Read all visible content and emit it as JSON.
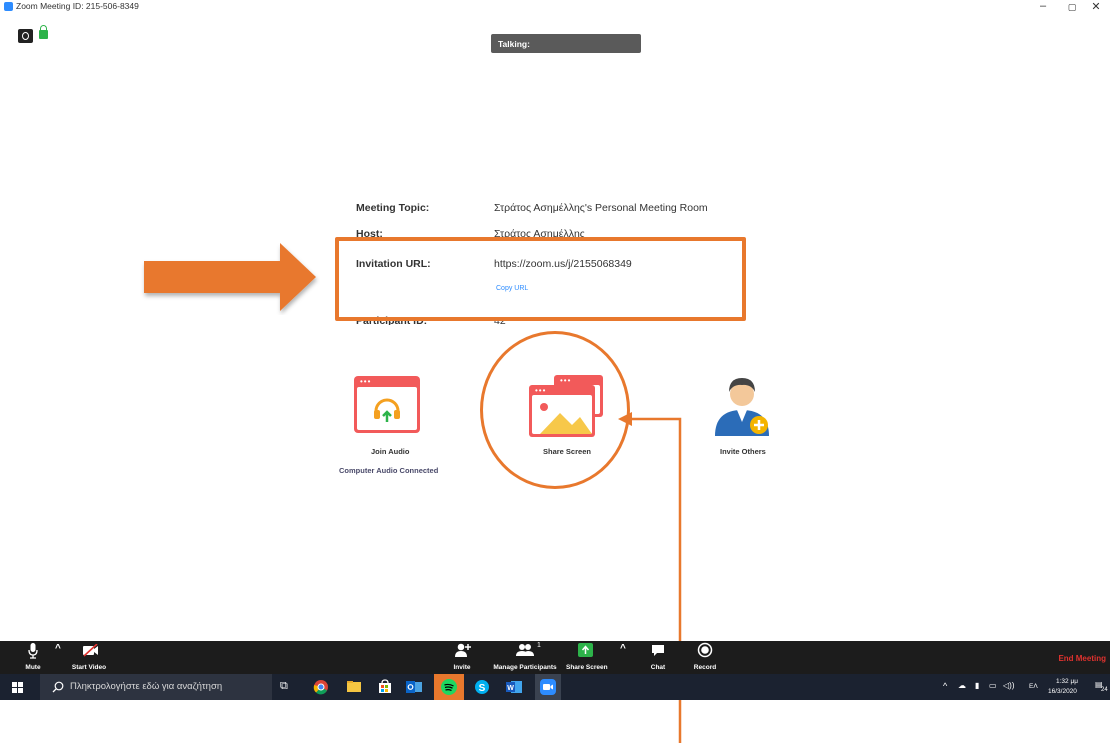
{
  "window": {
    "title": "Zoom Meeting ID: 215-506-8349",
    "minimize": "–",
    "restore": "▢",
    "close": "✕"
  },
  "talking": {
    "label": "Talking:"
  },
  "meeting_info": {
    "topic_label": "Meeting Topic:",
    "topic_value": "Στράτος Ασημέλλης's Personal Meeting Room",
    "host_label": "Host:",
    "host_value": "Στράτος Ασημέλλης",
    "invitation_label": "Invitation URL:",
    "invitation_value": "https://zoom.us/j/2155068349",
    "copy_url": "Copy URL",
    "participant_label": "Participant ID:",
    "participant_value": "42"
  },
  "actions": {
    "join_audio": "Join Audio",
    "join_audio_sub": "Computer Audio Connected",
    "share_screen": "Share Screen",
    "invite_others": "Invite Others"
  },
  "toolbar": {
    "mute": "Mute",
    "start_video": "Start Video",
    "invite": "Invite",
    "manage_participants": "Manage Participants",
    "participant_count": "1",
    "share_screen": "Share Screen",
    "chat": "Chat",
    "record": "Record",
    "end_meeting": "End Meeting"
  },
  "taskbar": {
    "search_placeholder": "Πληκτρολογήστε εδώ για αναζήτηση",
    "language": "ΕΛ",
    "time": "1:32 μμ",
    "date": "16/3/2020",
    "notifications": "24"
  },
  "colors": {
    "highlight": "#e8782d",
    "accent": "#2d8cff",
    "icon_red": "#f25a5a",
    "toolbar_bg": "#1c1c1c",
    "taskbar_bg": "#1b2230",
    "end_meeting": "#e0322e"
  }
}
